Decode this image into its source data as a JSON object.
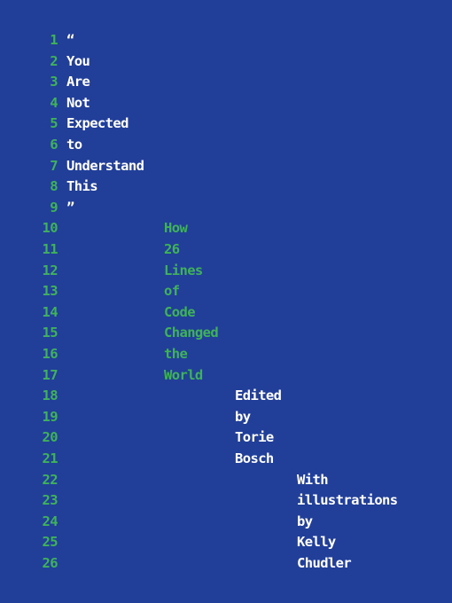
{
  "book_cover": {
    "title_lines": [
      "“",
      "You",
      "Are",
      "Not",
      "Expected",
      "to",
      "Understand",
      "This",
      "”"
    ],
    "subtitle_lines": [
      "How",
      "26",
      "Lines",
      "of",
      "Code",
      "Changed",
      "the",
      "World"
    ],
    "editor_lines": [
      "Edited",
      "by",
      "Torie",
      "Bosch"
    ],
    "illustrator_lines": [
      "With",
      "illustrations",
      "by",
      "Kelly",
      "Chudler"
    ],
    "line_numbers": [
      "1",
      "2",
      "3",
      "4",
      "5",
      "6",
      "7",
      "8",
      "9",
      "10",
      "11",
      "12",
      "13",
      "14",
      "15",
      "16",
      "17",
      "18",
      "19",
      "20",
      "21",
      "22",
      "23",
      "24",
      "25",
      "26"
    ],
    "colors": {
      "background": "#213f99",
      "accent_green": "#3fb25a",
      "text_white": "#ffffff"
    }
  }
}
